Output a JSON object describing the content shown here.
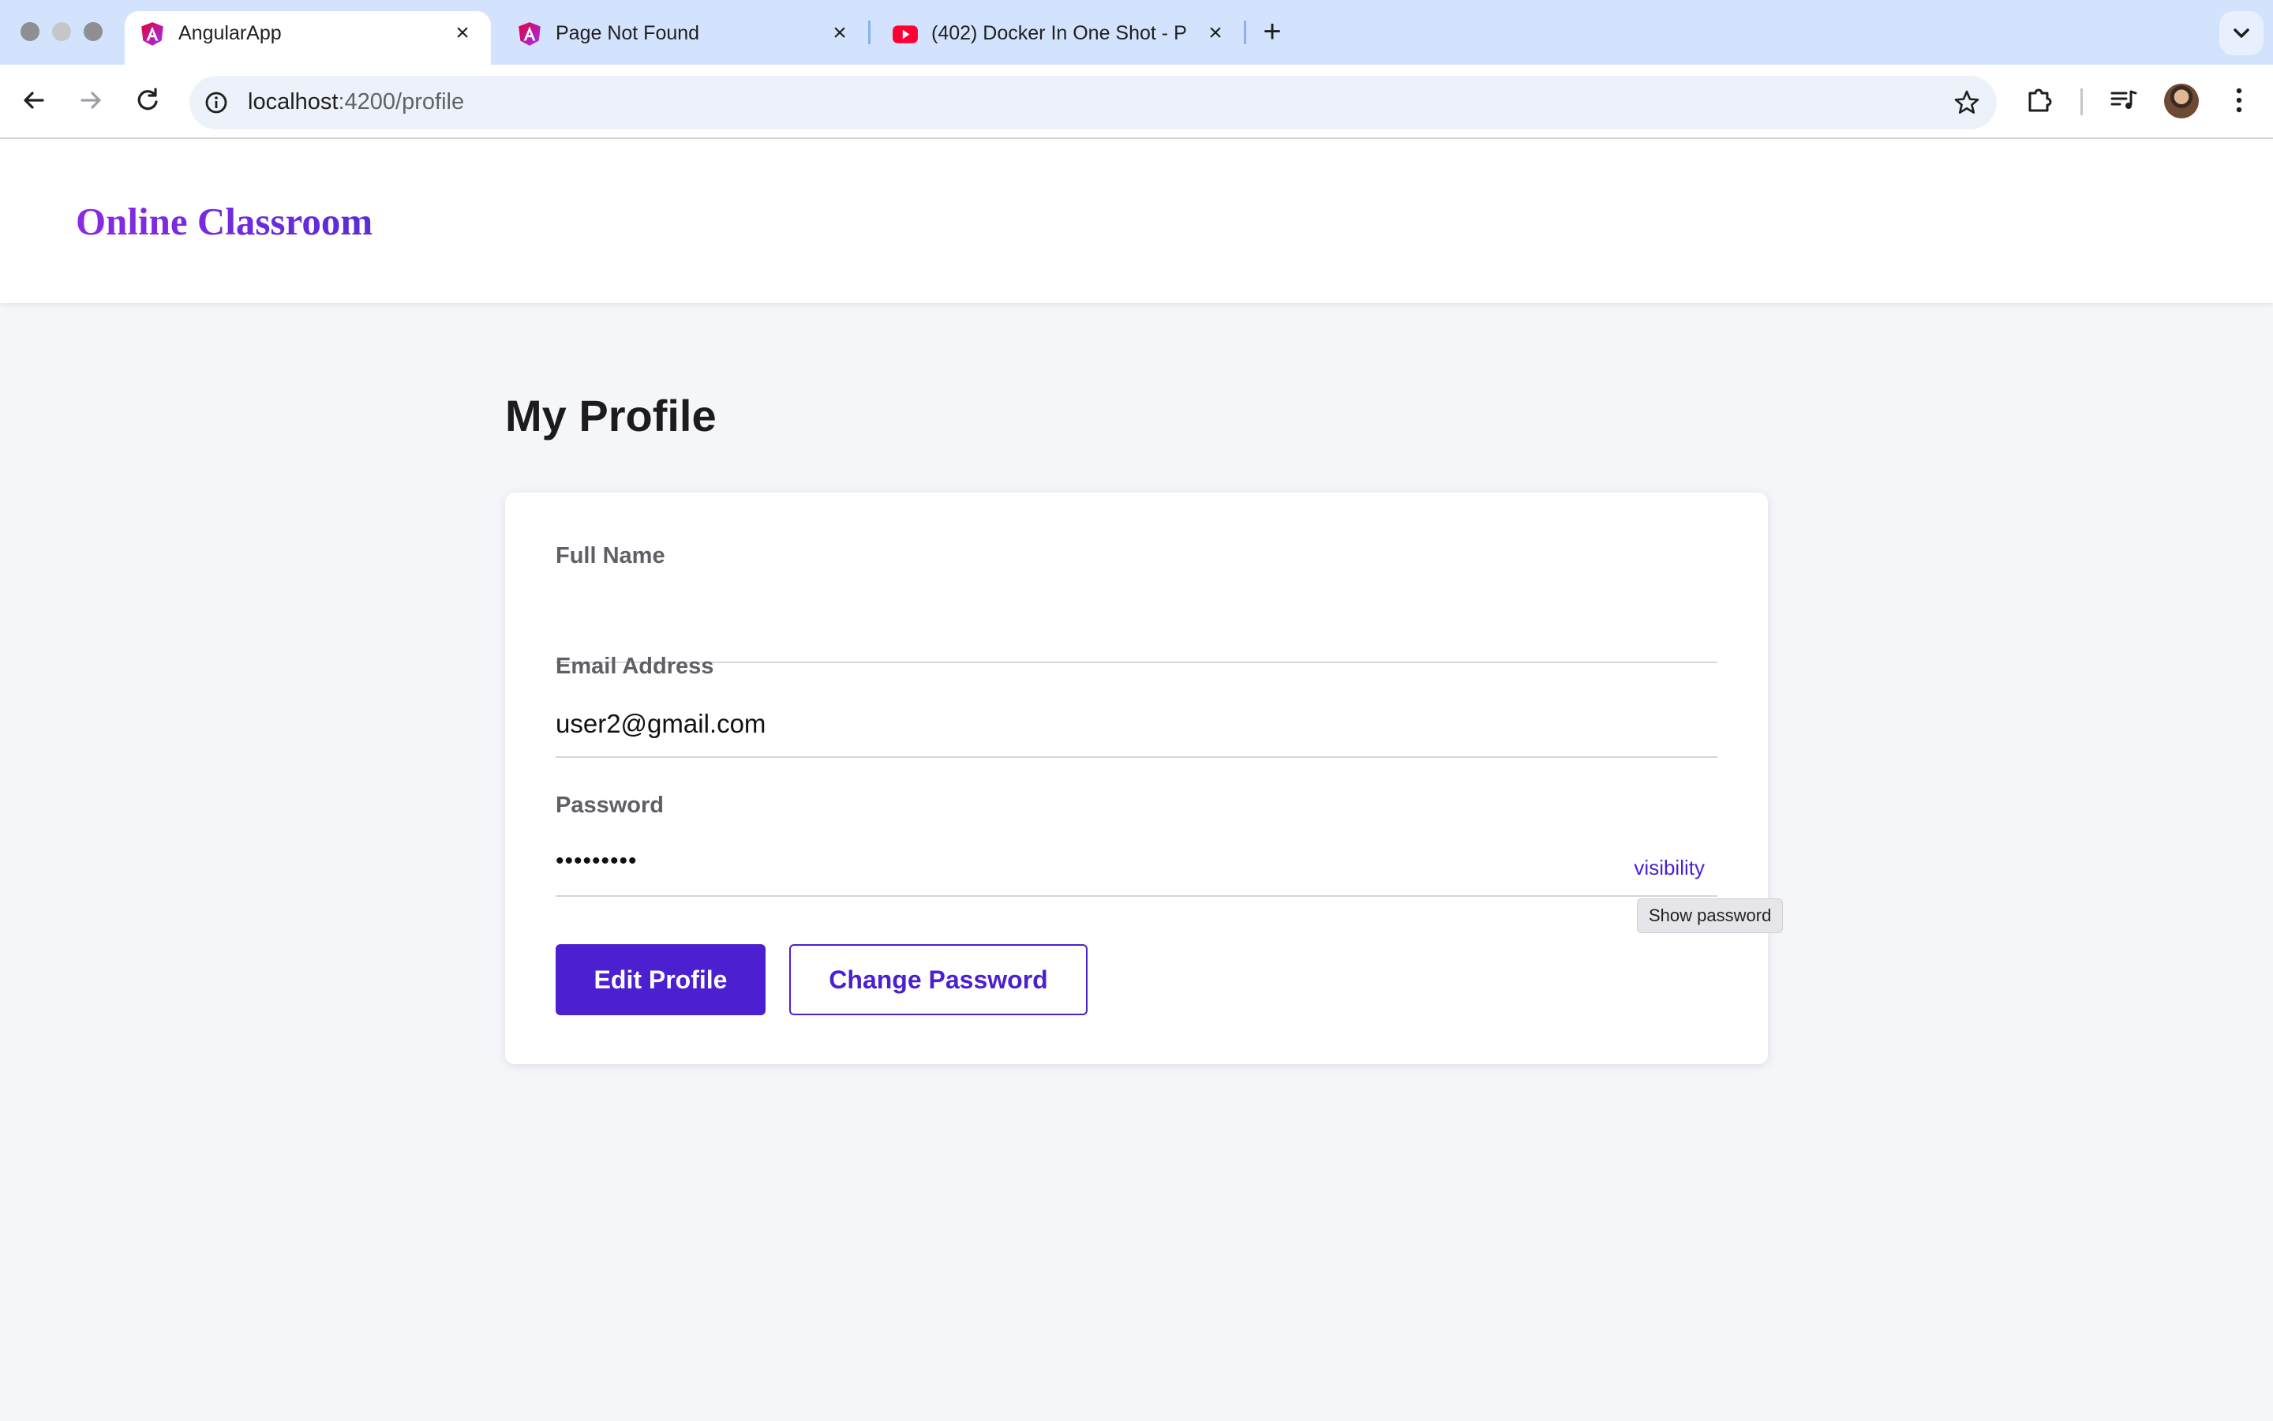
{
  "browser": {
    "tabs": [
      {
        "title": "AngularApp",
        "favicon": "angular-icon",
        "active": true
      },
      {
        "title": "Page Not Found",
        "favicon": "angular-icon",
        "active": false
      },
      {
        "title": "(402) Docker In One Shot - P",
        "favicon": "youtube-icon",
        "active": false
      }
    ],
    "url_host": "localhost",
    "url_path": ":4200/profile"
  },
  "app": {
    "brand": "Online Classroom"
  },
  "profile": {
    "page_title": "My Profile",
    "full_name_label": "Full Name",
    "full_name_value": "",
    "email_label": "Email Address",
    "email_value": "user2@gmail.com",
    "password_label": "Password",
    "password_value": "•••••••••",
    "visibility_toggle": "visibility",
    "tooltip": "Show password",
    "edit_button": "Edit Profile",
    "change_password_button": "Change Password"
  },
  "colors": {
    "primary": "#4c1fd0",
    "brand_gradient_start": "#8a2be2",
    "tabstrip": "#d3e3fd",
    "page_background": "#f5f6fa"
  }
}
